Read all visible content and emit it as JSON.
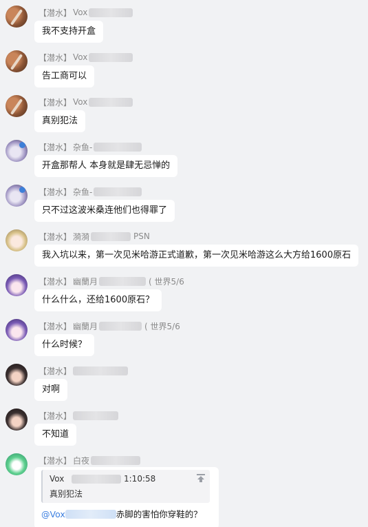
{
  "messages": [
    {
      "id": 1,
      "tag": "【潜水】",
      "nick": "Vox",
      "extra": "",
      "text": "我不支持开盒",
      "avatar": "avatar-brown"
    },
    {
      "id": 2,
      "tag": "【潜水】",
      "nick": "Vox",
      "extra": "",
      "text": "告工商可以",
      "avatar": "avatar-brown"
    },
    {
      "id": 3,
      "tag": "【潜水】",
      "nick": "Vox",
      "extra": "",
      "text": "真别犯法",
      "avatar": "avatar-brown"
    },
    {
      "id": 4,
      "tag": "【潜水】",
      "nick": "杂鱼-",
      "extra": "",
      "text": "开盒那帮人 本身就是肆无忌惮的",
      "avatar": "avatar-fish"
    },
    {
      "id": 5,
      "tag": "【潜水】",
      "nick": "杂鱼-",
      "extra": "",
      "text": "只不过这波米桑连他们也得罪了",
      "avatar": "avatar-fish"
    },
    {
      "id": 6,
      "tag": "【潜水】",
      "nick": "漪漪",
      "extra": "PSN",
      "text": "我入坑以来，第一次见米哈游正式道歉，第一次见米哈游这么大方给1600原石",
      "avatar": "avatar-anime"
    },
    {
      "id": 7,
      "tag": "【潜水】",
      "nick": "幽蘭月",
      "extra": "( 世界5/6",
      "text": "什么什么，还给1600原石？",
      "avatar": "avatar-purple"
    },
    {
      "id": 8,
      "tag": "【潜水】",
      "nick": "幽蘭月",
      "extra": "( 世界5/6",
      "text": "什么时候？",
      "avatar": "avatar-purple"
    },
    {
      "id": 9,
      "tag": "【潜水】",
      "nick": "",
      "extra": "",
      "text": "对啊",
      "avatar": "avatar-girl"
    },
    {
      "id": 10,
      "tag": "【潜水】",
      "nick": "",
      "extra": "",
      "text": "不知道",
      "avatar": "avatar-girl"
    }
  ],
  "reply_message": {
    "tag": "【潜水】",
    "nick": "白夜",
    "quote_user": "Vox",
    "quote_time": "1:10:58",
    "quote_text": "真别犯法",
    "mention": "@Vox",
    "text": "赤脚的害怕你穿鞋的？",
    "avatar": "avatar-green"
  },
  "colors": {
    "background": "#f1f2f4",
    "bubble": "#ffffff",
    "meta_text": "#8a8a8a",
    "mention": "#3c7fe0"
  },
  "icons": {
    "quote_jump": "jump-to-message-icon"
  }
}
